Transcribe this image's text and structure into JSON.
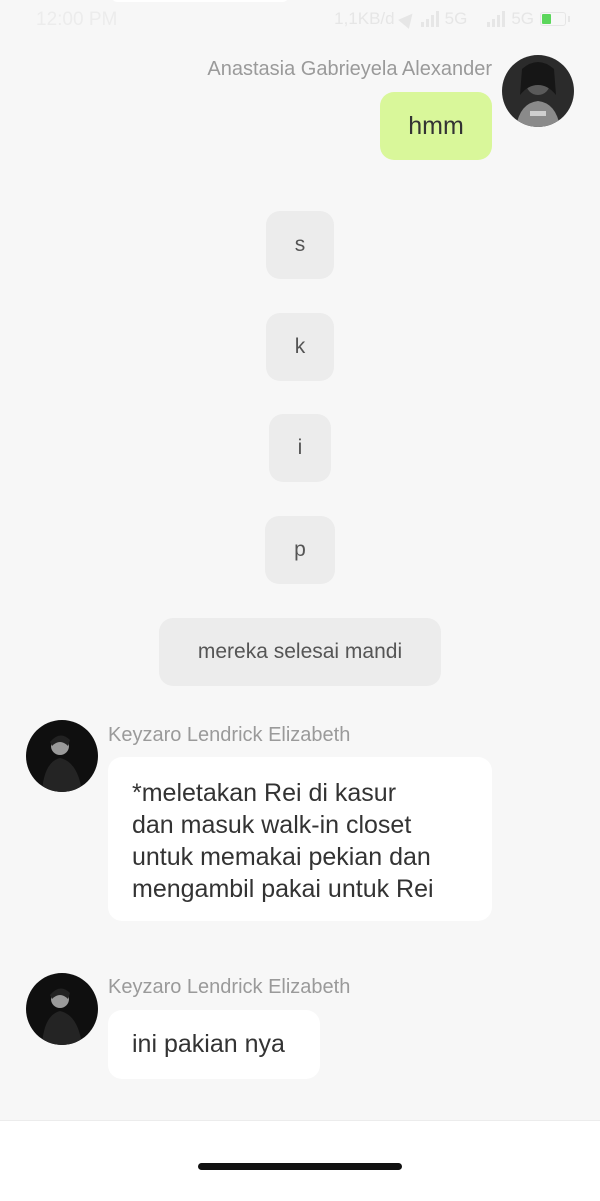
{
  "status_bar": {
    "time": "12:00 PM",
    "speed": "1,1KB/d",
    "network1": "5G",
    "network2": "5G",
    "battery": "54"
  },
  "messages": {
    "outgoing": {
      "sender": "Anastasia Gabrieyela Alexander",
      "text": "hmm"
    },
    "narration": [
      "s",
      "k",
      "i",
      "p",
      "mereka selesai mandi"
    ],
    "incoming": [
      {
        "sender": "Keyzaro Lendrick Elizabeth",
        "lines": [
          "*meletakan Rei di kasur",
          "dan masuk walk-in closet",
          "untuk memakai pekian dan",
          "mengambil pakai untuk Rei"
        ]
      },
      {
        "sender": "Keyzaro Lendrick Elizabeth",
        "lines": [
          "ini pakian nya"
        ]
      }
    ]
  }
}
